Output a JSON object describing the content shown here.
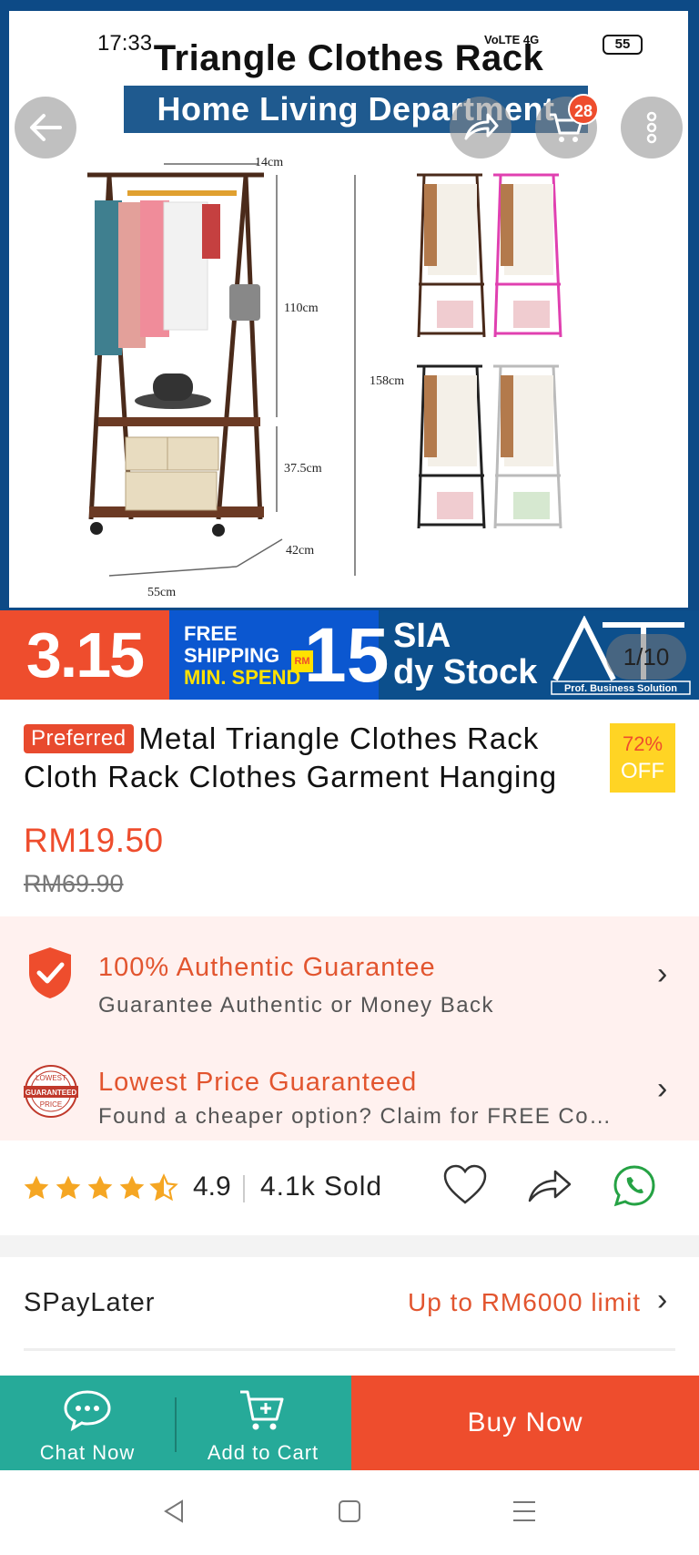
{
  "status_bar": {
    "time": "17:33",
    "network": "VoLTE 4G",
    "battery": "55"
  },
  "product_image": {
    "title": "Triangle Clothes Rack",
    "subtitle": "Home Living Department",
    "cart_badge": "28",
    "counter": "1/10",
    "dimensions": {
      "width_top": "14cm",
      "height_upper": "110cm",
      "height_total": "158cm",
      "height_lower": "37.5cm",
      "depth": "42cm",
      "width_base": "55cm"
    },
    "promo": {
      "date": "3.15",
      "free_shipping_line1": "FREE",
      "free_shipping_line2": "SHIPPING",
      "free_shipping_line3": "MIN. SPEND",
      "currency": "RM",
      "amount": "15",
      "right_line1": "SIA",
      "right_line2": "dy Stock",
      "logo_caption": "Prof. Business Solution"
    }
  },
  "product": {
    "preferred_label": "Preferred",
    "title": "Metal Triangle Clothes Rack Cloth Rack Clothes Garment Hanging",
    "discount_percent": "72%",
    "discount_word": "OFF",
    "price": "RM19.50",
    "old_price": "RM69.90"
  },
  "guarantees": [
    {
      "title": "100% Authentic Guarantee",
      "subtitle": "Guarantee Authentic or Money Back"
    },
    {
      "title": "Lowest Price Guaranteed",
      "subtitle": "Found a cheaper option? Claim for FREE Co…"
    }
  ],
  "lowest_price_badge": {
    "top": "LOWEST",
    "middle": "GUARANTEED",
    "bottom": "PRICE"
  },
  "rating": {
    "value": "4.9",
    "stars": 4.5,
    "sold": "4.1k Sold"
  },
  "spaylater": {
    "label": "SPayLater",
    "limit": "Up to RM6000 limit"
  },
  "actions": {
    "chat_label": "Chat Now",
    "cart_label": "Add to Cart",
    "buy_label": "Buy Now"
  },
  "colors": {
    "brand_orange": "#ee4d2d",
    "teal": "#26aa99",
    "star": "#f5a623"
  }
}
